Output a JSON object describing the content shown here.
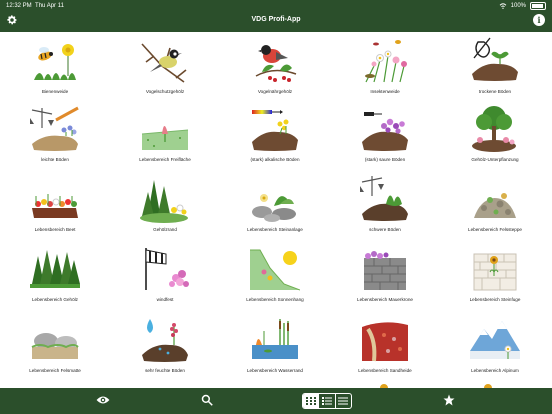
{
  "status": {
    "time": "12:32 PM",
    "date": "Thu Apr 11",
    "battery": "100%"
  },
  "app": {
    "title": "VDG Profi-App"
  },
  "tiles": [
    {
      "label": "Bienenweide",
      "icon": "bee-icon"
    },
    {
      "label": "Vogelschutzgehölz",
      "icon": "bird-branch-icon"
    },
    {
      "label": "Vogelnährgehölz",
      "icon": "bullfinch-berries-icon"
    },
    {
      "label": "Insektenweide",
      "icon": "insects-flowers-icon"
    },
    {
      "label": "trockene Böden",
      "icon": "dry-soil-icon"
    },
    {
      "label": "leichte Böden",
      "icon": "light-soil-scale-icon"
    },
    {
      "label": "Lebensbereich Freifläche",
      "icon": "open-area-icon"
    },
    {
      "label": "(stark) alkalische Böden",
      "icon": "alkaline-soil-icon"
    },
    {
      "label": "(stark) saure Böden",
      "icon": "acidic-soil-icon"
    },
    {
      "label": "Gehölz-Unterpflanzung",
      "icon": "underplanting-icon"
    },
    {
      "label": "Lebensbereich Beet",
      "icon": "flower-bed-icon"
    },
    {
      "label": "Gehölzrand",
      "icon": "woodland-edge-icon"
    },
    {
      "label": "Lebensbereich Steinanlage",
      "icon": "rock-garden-icon"
    },
    {
      "label": "schwere Böden",
      "icon": "heavy-soil-scale-icon"
    },
    {
      "label": "Lebensbereich Felssteppe",
      "icon": "rock-steppe-icon"
    },
    {
      "label": "Lebensbereich Gehölz",
      "icon": "forest-icon"
    },
    {
      "label": "windfest",
      "icon": "windsock-icon"
    },
    {
      "label": "Lebensbereich Sonnenhang",
      "icon": "sunny-slope-icon"
    },
    {
      "label": "Lebensbereich Mauerkrone",
      "icon": "wall-crown-icon"
    },
    {
      "label": "Lebensbereich Steinfuge",
      "icon": "stone-joint-icon"
    },
    {
      "label": "Lebensbereich Felsmatte",
      "icon": "rock-mat-icon"
    },
    {
      "label": "sehr feuchte Böden",
      "icon": "wet-soil-icon"
    },
    {
      "label": "Lebensbereich Wasserrand",
      "icon": "water-edge-icon"
    },
    {
      "label": "Lebensbereich Sandheide",
      "icon": "sand-heath-icon"
    },
    {
      "label": "Lebensbereich Alpinum",
      "icon": "alpine-icon"
    }
  ],
  "colors": {
    "bar": "#2b4f2b",
    "soil": "#5a3f2b",
    "grass": "#4c9a36",
    "text": "#222222"
  }
}
